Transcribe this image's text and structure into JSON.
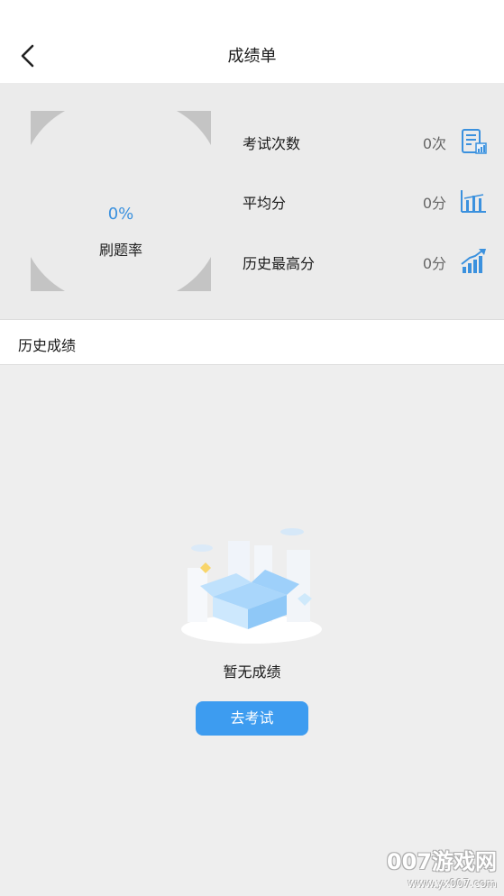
{
  "header": {
    "title": "成绩单",
    "back_icon": "chevron-left-icon"
  },
  "stats": {
    "rate_value": "0%",
    "rate_label": "刷题率",
    "rows": [
      {
        "label": "考试次数",
        "value": "0次",
        "icon": "exam-report-icon"
      },
      {
        "label": "平均分",
        "value": "0分",
        "icon": "bar-chart-icon"
      },
      {
        "label": "历史最高分",
        "value": "0分",
        "icon": "trend-up-icon"
      }
    ],
    "accent_color": "#3b91de"
  },
  "history": {
    "title": "历史成绩"
  },
  "empty": {
    "message": "暂无成绩",
    "button_label": "去考试",
    "button_color": "#3d9cf0"
  },
  "watermark": {
    "main": "007游戏网",
    "sub": "www.yx007.com"
  }
}
